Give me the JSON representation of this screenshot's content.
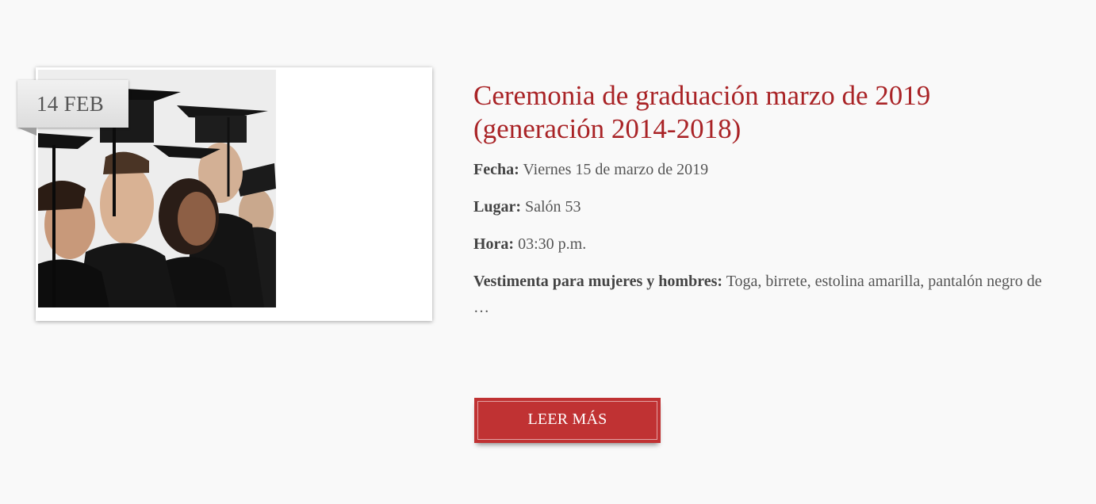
{
  "post": {
    "date_badge": "14 FEB",
    "image_alt": "graduates-photo",
    "title_line1": "Ceremonia de graduación marzo de 2019",
    "title_line2": "(generación 2014-2018)",
    "fields": {
      "fecha_label": "Fecha:",
      "fecha_value": "Viernes 15 de marzo de 2019",
      "lugar_label": "Lugar:",
      "lugar_value": "Salón 53",
      "hora_label": "Hora:",
      "hora_value": "03:30 p.m.",
      "vestimenta_label": "Vestimenta para mujeres y hombres:",
      "vestimenta_value": "Toga, birrete, estolina amarilla, pantalón negro de"
    },
    "ellipsis": "…",
    "read_more_label": "LEER MÁS"
  },
  "colors": {
    "accent": "#a92326",
    "button": "#c03233",
    "background": "#f9f9f9"
  }
}
